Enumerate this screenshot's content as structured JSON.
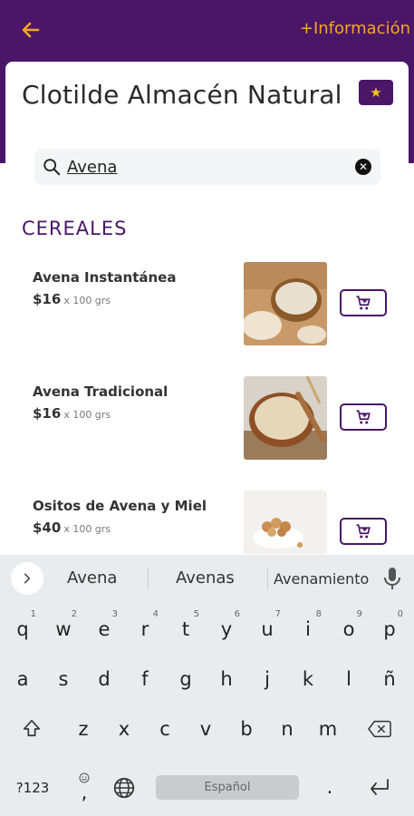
{
  "header": {
    "back_icon": "arrow-left-icon",
    "info_link": "+Información",
    "bg_color": "#4a1668",
    "accent_color": "#f5a623"
  },
  "store": {
    "name": "Clotilde Almacén Natural",
    "favorite_icon": "star-icon"
  },
  "search": {
    "value": "Avena",
    "icon": "search-icon",
    "clear_icon": "clear-icon"
  },
  "section": {
    "title": "CEREALES"
  },
  "products": [
    {
      "name": "Avena Instantánea",
      "price": "$16",
      "unit": "x 100 grs",
      "cart_icon": "cart-icon"
    },
    {
      "name": "Avena Tradicional",
      "price": "$16",
      "unit": "x 100 grs",
      "cart_icon": "cart-icon"
    },
    {
      "name": "Ositos de Avena y Miel",
      "price": "$40",
      "unit": "x 100 grs",
      "cart_icon": "cart-icon"
    }
  ],
  "keyboard": {
    "suggestions": [
      "Avena",
      "Avenas",
      "Avenamiento"
    ],
    "row1": [
      {
        "key": "q",
        "hint": "1"
      },
      {
        "key": "w",
        "hint": "2"
      },
      {
        "key": "e",
        "hint": "3"
      },
      {
        "key": "r",
        "hint": "4"
      },
      {
        "key": "t",
        "hint": "5"
      },
      {
        "key": "y",
        "hint": "6"
      },
      {
        "key": "u",
        "hint": "7"
      },
      {
        "key": "i",
        "hint": "8"
      },
      {
        "key": "o",
        "hint": "9"
      },
      {
        "key": "p",
        "hint": "0"
      }
    ],
    "row2": [
      "a",
      "s",
      "d",
      "f",
      "g",
      "h",
      "j",
      "k",
      "l",
      "ñ"
    ],
    "row3": [
      "z",
      "x",
      "c",
      "v",
      "b",
      "n",
      "m"
    ],
    "symbols_key": "?123",
    "emoji_comma": ",",
    "space_label": "Español",
    "period_key": "."
  }
}
